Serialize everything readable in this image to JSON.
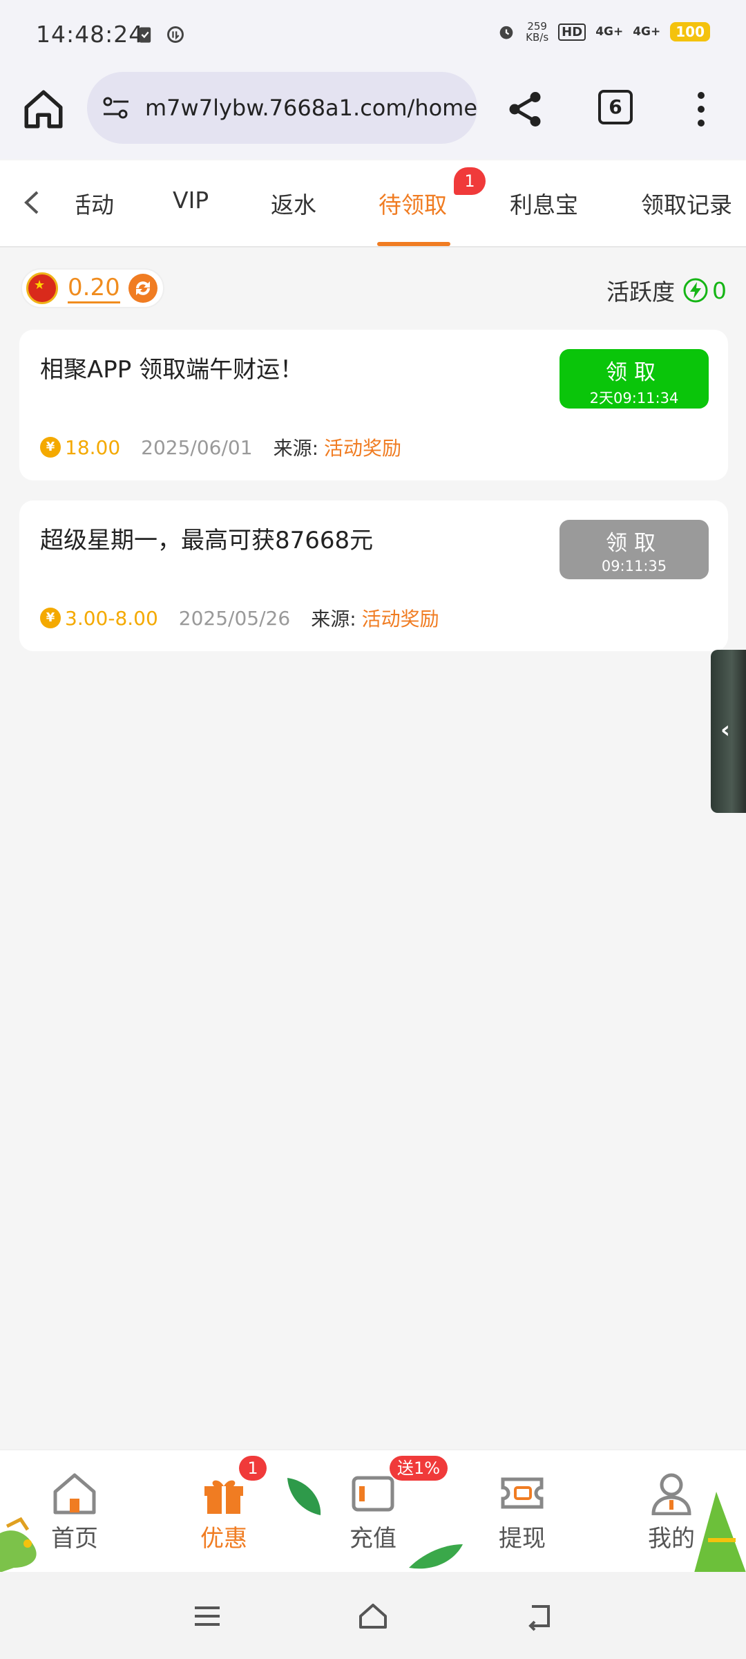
{
  "status_bar": {
    "time": "14:48:24",
    "speed_value": "259",
    "speed_unit": "KB/s",
    "hd": "HD",
    "network1": "4G+",
    "network2": "4G+",
    "battery": "100"
  },
  "browser": {
    "url": "m7w7lybw.7668a1.com/home/",
    "tab_count": "6"
  },
  "tabs": [
    {
      "label": "活动"
    },
    {
      "label": "VIP"
    },
    {
      "label": "返水"
    },
    {
      "label": "待领取",
      "badge": "1"
    },
    {
      "label": "利息宝"
    },
    {
      "label": "领取记录"
    }
  ],
  "tab_visible": {
    "first_partial": "活动"
  },
  "balance": {
    "value": "0.20"
  },
  "activity": {
    "label": "活跃度",
    "value": "0"
  },
  "rewards": [
    {
      "title": "相聚APP 领取端午财运！",
      "button_label": "领取",
      "button_sub": "2天09:11:34",
      "amount": "18.00",
      "date": "2025/06/01",
      "source_label": "来源:",
      "source_value": "活动奖励"
    },
    {
      "title": "超级星期一，最高可获87668元",
      "button_label": "领取",
      "button_sub": "09:11:35",
      "amount": "3.00-8.00",
      "date": "2025/05/26",
      "source_label": "来源:",
      "source_value": "活动奖励"
    }
  ],
  "side_handle": {
    "label": "‹"
  },
  "bottom_nav": [
    {
      "label": "首页",
      "icon": "home-icon"
    },
    {
      "label": "优惠",
      "icon": "gift-icon",
      "badge": "1",
      "active": true
    },
    {
      "label": "充值",
      "icon": "wallet-icon",
      "badge": "送1%"
    },
    {
      "label": "提现",
      "icon": "withdraw-icon"
    },
    {
      "label": "我的",
      "icon": "user-icon"
    }
  ],
  "colors": {
    "accent": "#f07c22",
    "green": "#0ac50a",
    "gray_button": "#9a9a9a",
    "coin": "#f4a900",
    "badge": "#f03a3a"
  }
}
